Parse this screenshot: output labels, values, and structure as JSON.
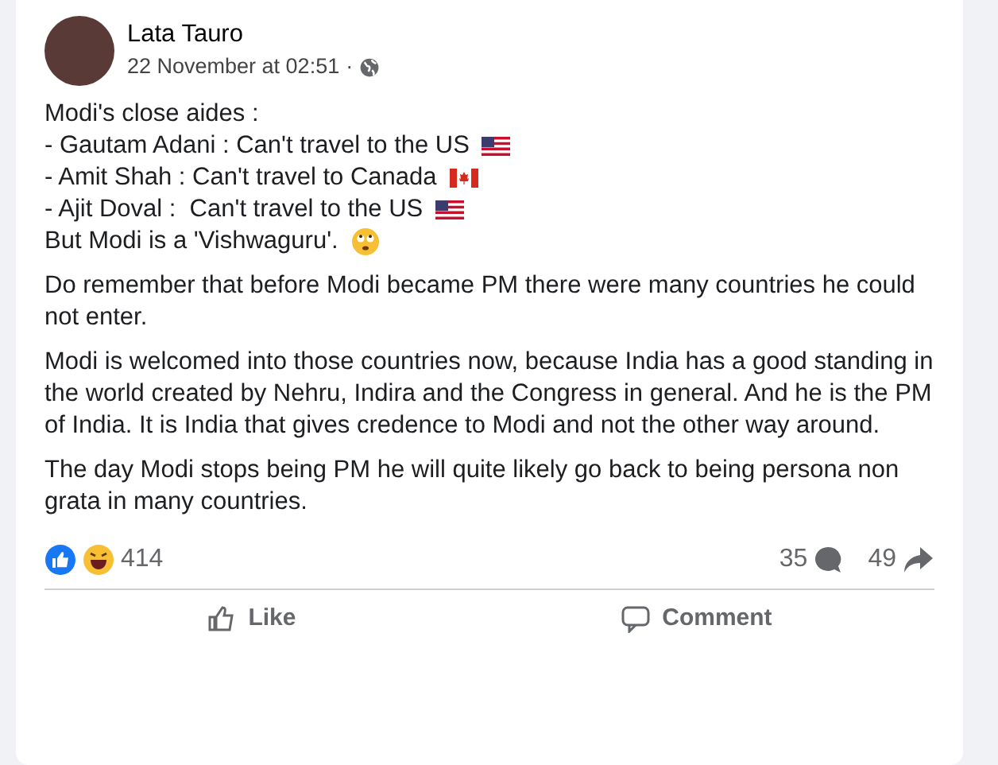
{
  "post": {
    "author": "Lata Tauro",
    "timestamp": "22 November at 02:51",
    "separator": "·",
    "lines": [
      {
        "kind": "plain",
        "text": "Modi's close aides :"
      },
      {
        "kind": "flag_us",
        "text": "- Gautam Adani : Can't travel to the US"
      },
      {
        "kind": "flag_ca",
        "text": "- Amit Shah : Can't travel to Canada"
      },
      {
        "kind": "flag_us",
        "text": "- Ajit Doval :  Can't travel to the US"
      },
      {
        "kind": "emoji",
        "text": "But Modi is a 'Vishwaguru'."
      }
    ],
    "paragraphs": [
      "Do remember that before Modi became PM there were many countries he could not enter.",
      "Modi is welcomed into those countries now, because India has a good standing in the world  created by Nehru, Indira and the Congress in general. And he is the PM of India. It is India that gives credence to Modi and not the other way around.",
      "The day Modi stops being PM he will quite likely go back to being persona non grata in many countries."
    ],
    "reaction_count": "414",
    "comment_count": "35",
    "share_count": "49",
    "actions": [
      "Like",
      "Comment"
    ]
  }
}
